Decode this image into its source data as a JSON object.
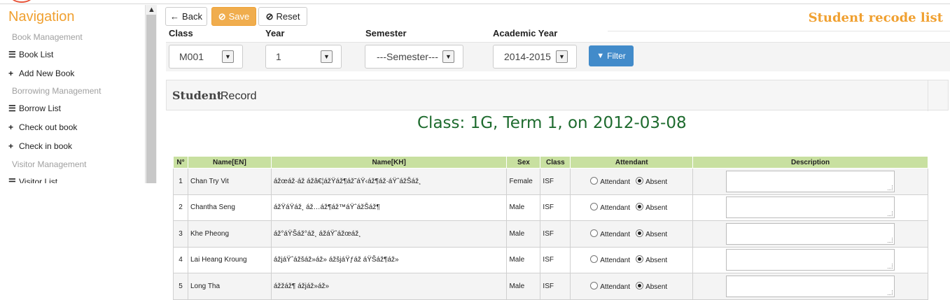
{
  "sidebar": {
    "title": "Navigation",
    "sections": [
      {
        "label": "Book Management"
      },
      {
        "label": "Borrowing Management"
      },
      {
        "label": "Visitor Management"
      }
    ],
    "items": [
      {
        "label": "Book List",
        "icon": "list-icon"
      },
      {
        "label": "Add New Book",
        "icon": "plus-icon"
      },
      {
        "label": "Borrow List",
        "icon": "list-icon"
      },
      {
        "label": "Check out book",
        "icon": "plus-icon"
      },
      {
        "label": "Check in book",
        "icon": "plus-icon"
      },
      {
        "label": "Visitor List",
        "icon": "list-icon"
      }
    ]
  },
  "toolbar": {
    "back_label": "Back",
    "save_label": "Save",
    "reset_label": "Reset"
  },
  "page_title": "Student recode list",
  "filters": {
    "class": {
      "label": "Class",
      "value": "M001"
    },
    "year": {
      "label": "Year",
      "value": "1"
    },
    "semester": {
      "label": "Semester",
      "value": "---Semester---"
    },
    "academic_year": {
      "label": "Academic Year",
      "value": "2014-2015"
    },
    "filter_label": "Filter"
  },
  "record": {
    "heading_bold": "Student",
    "heading_text": "Record",
    "class_info": "Class: 1G, Term 1, on 2012-03-08"
  },
  "table": {
    "columns": [
      "N°",
      "Name[EN]",
      "Name[KH]",
      "Sex",
      "Class",
      "Attendant",
      "Description"
    ],
    "option_attendant": "Attendant",
    "option_absent": "Absent",
    "rows": [
      {
        "no": "1",
        "name_en": "Chan Try Vit",
        "name_kh": "ážœáž·áž ážâ€¦ážŸáž¶áž˜áŸ‹áž¶áž·áŸˆážŠáž¸",
        "sex": "Female",
        "class": "ISF",
        "attendance": "absent"
      },
      {
        "no": "2",
        "name_en": "Chantha Seng",
        "name_kh": "ážŸáŸáž¸ áž…áž¶áž™áŸˆážŠáž¶",
        "sex": "Male",
        "class": "ISF",
        "attendance": "absent"
      },
      {
        "no": "3",
        "name_en": "Khe Pheong",
        "name_kh": "áž°áŸŠáž°áž¸ ážáŸˆážœáž¸",
        "sex": "Male",
        "class": "ISF",
        "attendance": "absent"
      },
      {
        "no": "4",
        "name_en": "Lai Heang Kroung",
        "name_kh": "ážjáŸˆážšáž»áž» ážšjáŸƒáž áŸŠáž¶áž»",
        "sex": "Male",
        "class": "ISF",
        "attendance": "absent"
      },
      {
        "no": "5",
        "name_en": "Long Tha",
        "name_kh": "ážžáž¶ ážjáž»áž»",
        "sex": "Male",
        "class": "ISF",
        "attendance": "absent"
      }
    ]
  }
}
